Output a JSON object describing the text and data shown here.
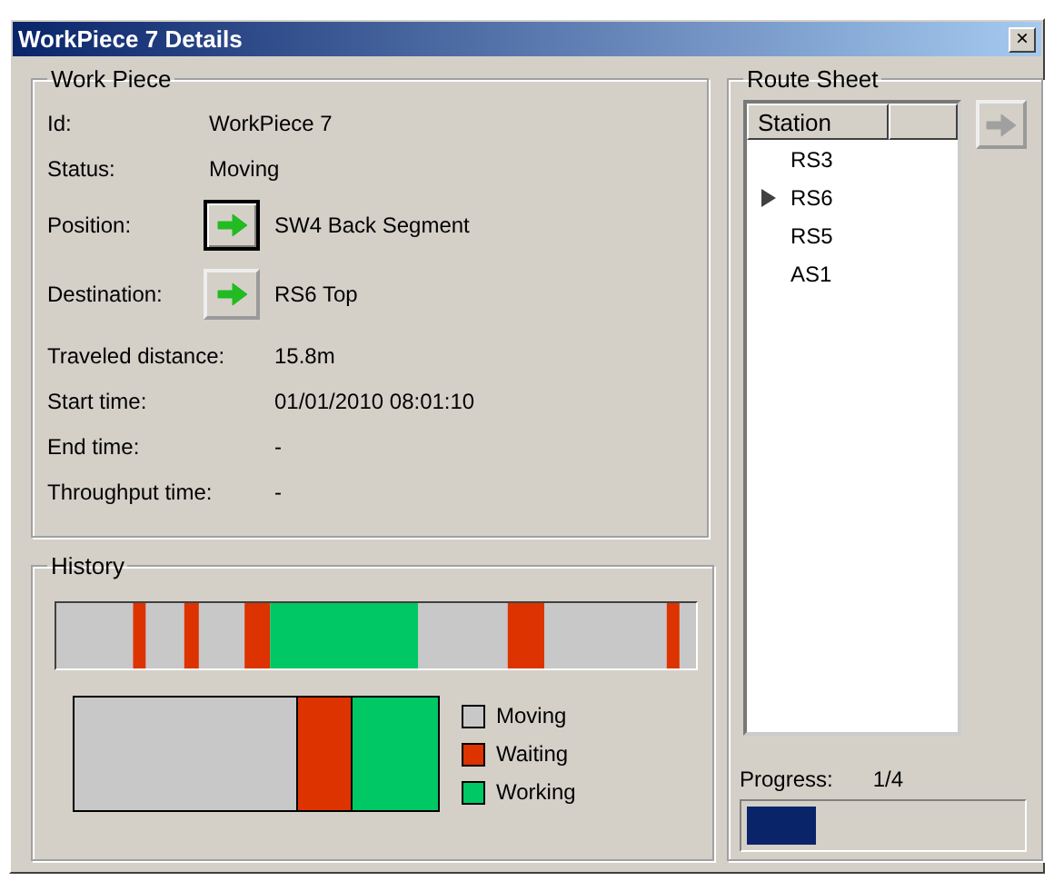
{
  "window": {
    "title": "WorkPiece 7 Details",
    "close_glyph": "×"
  },
  "work_piece": {
    "title": "Work Piece",
    "fields": [
      {
        "kind": "text",
        "label": "Id:",
        "value": "WorkPiece 7"
      },
      {
        "kind": "text",
        "label": "Status:",
        "value": "Moving"
      },
      {
        "kind": "link",
        "label": "Position:",
        "value": "SW4 Back Segment",
        "focused": true
      },
      {
        "kind": "link",
        "label": "Destination:",
        "value": "RS6 Top",
        "focused": false
      }
    ],
    "statistics": [
      {
        "label": "Traveled distance:",
        "value": "15.8m"
      },
      {
        "label": "Start time:",
        "value": "01/01/2010 08:01:10"
      },
      {
        "label": "End time:",
        "value": "-"
      },
      {
        "label": "Throughput time:",
        "value": "-"
      }
    ]
  },
  "history": {
    "title": "History",
    "legend": [
      {
        "label": "Moving",
        "color": "#c8c8c8"
      },
      {
        "label": "Waiting",
        "color": "#dd3300"
      },
      {
        "label": "Working",
        "color": "#00c864"
      }
    ]
  },
  "route_sheet": {
    "title": "Route Sheet",
    "columns": [
      "Station"
    ],
    "rows": [
      {
        "station": "RS3",
        "current": false
      },
      {
        "station": "RS6",
        "current": true
      },
      {
        "station": "RS5",
        "current": false
      },
      {
        "station": "AS1",
        "current": false
      }
    ],
    "go_button_disabled": true,
    "progress_label": "Progress:",
    "progress_value": "1/4",
    "progress": {
      "level": 0.25
    }
  }
}
